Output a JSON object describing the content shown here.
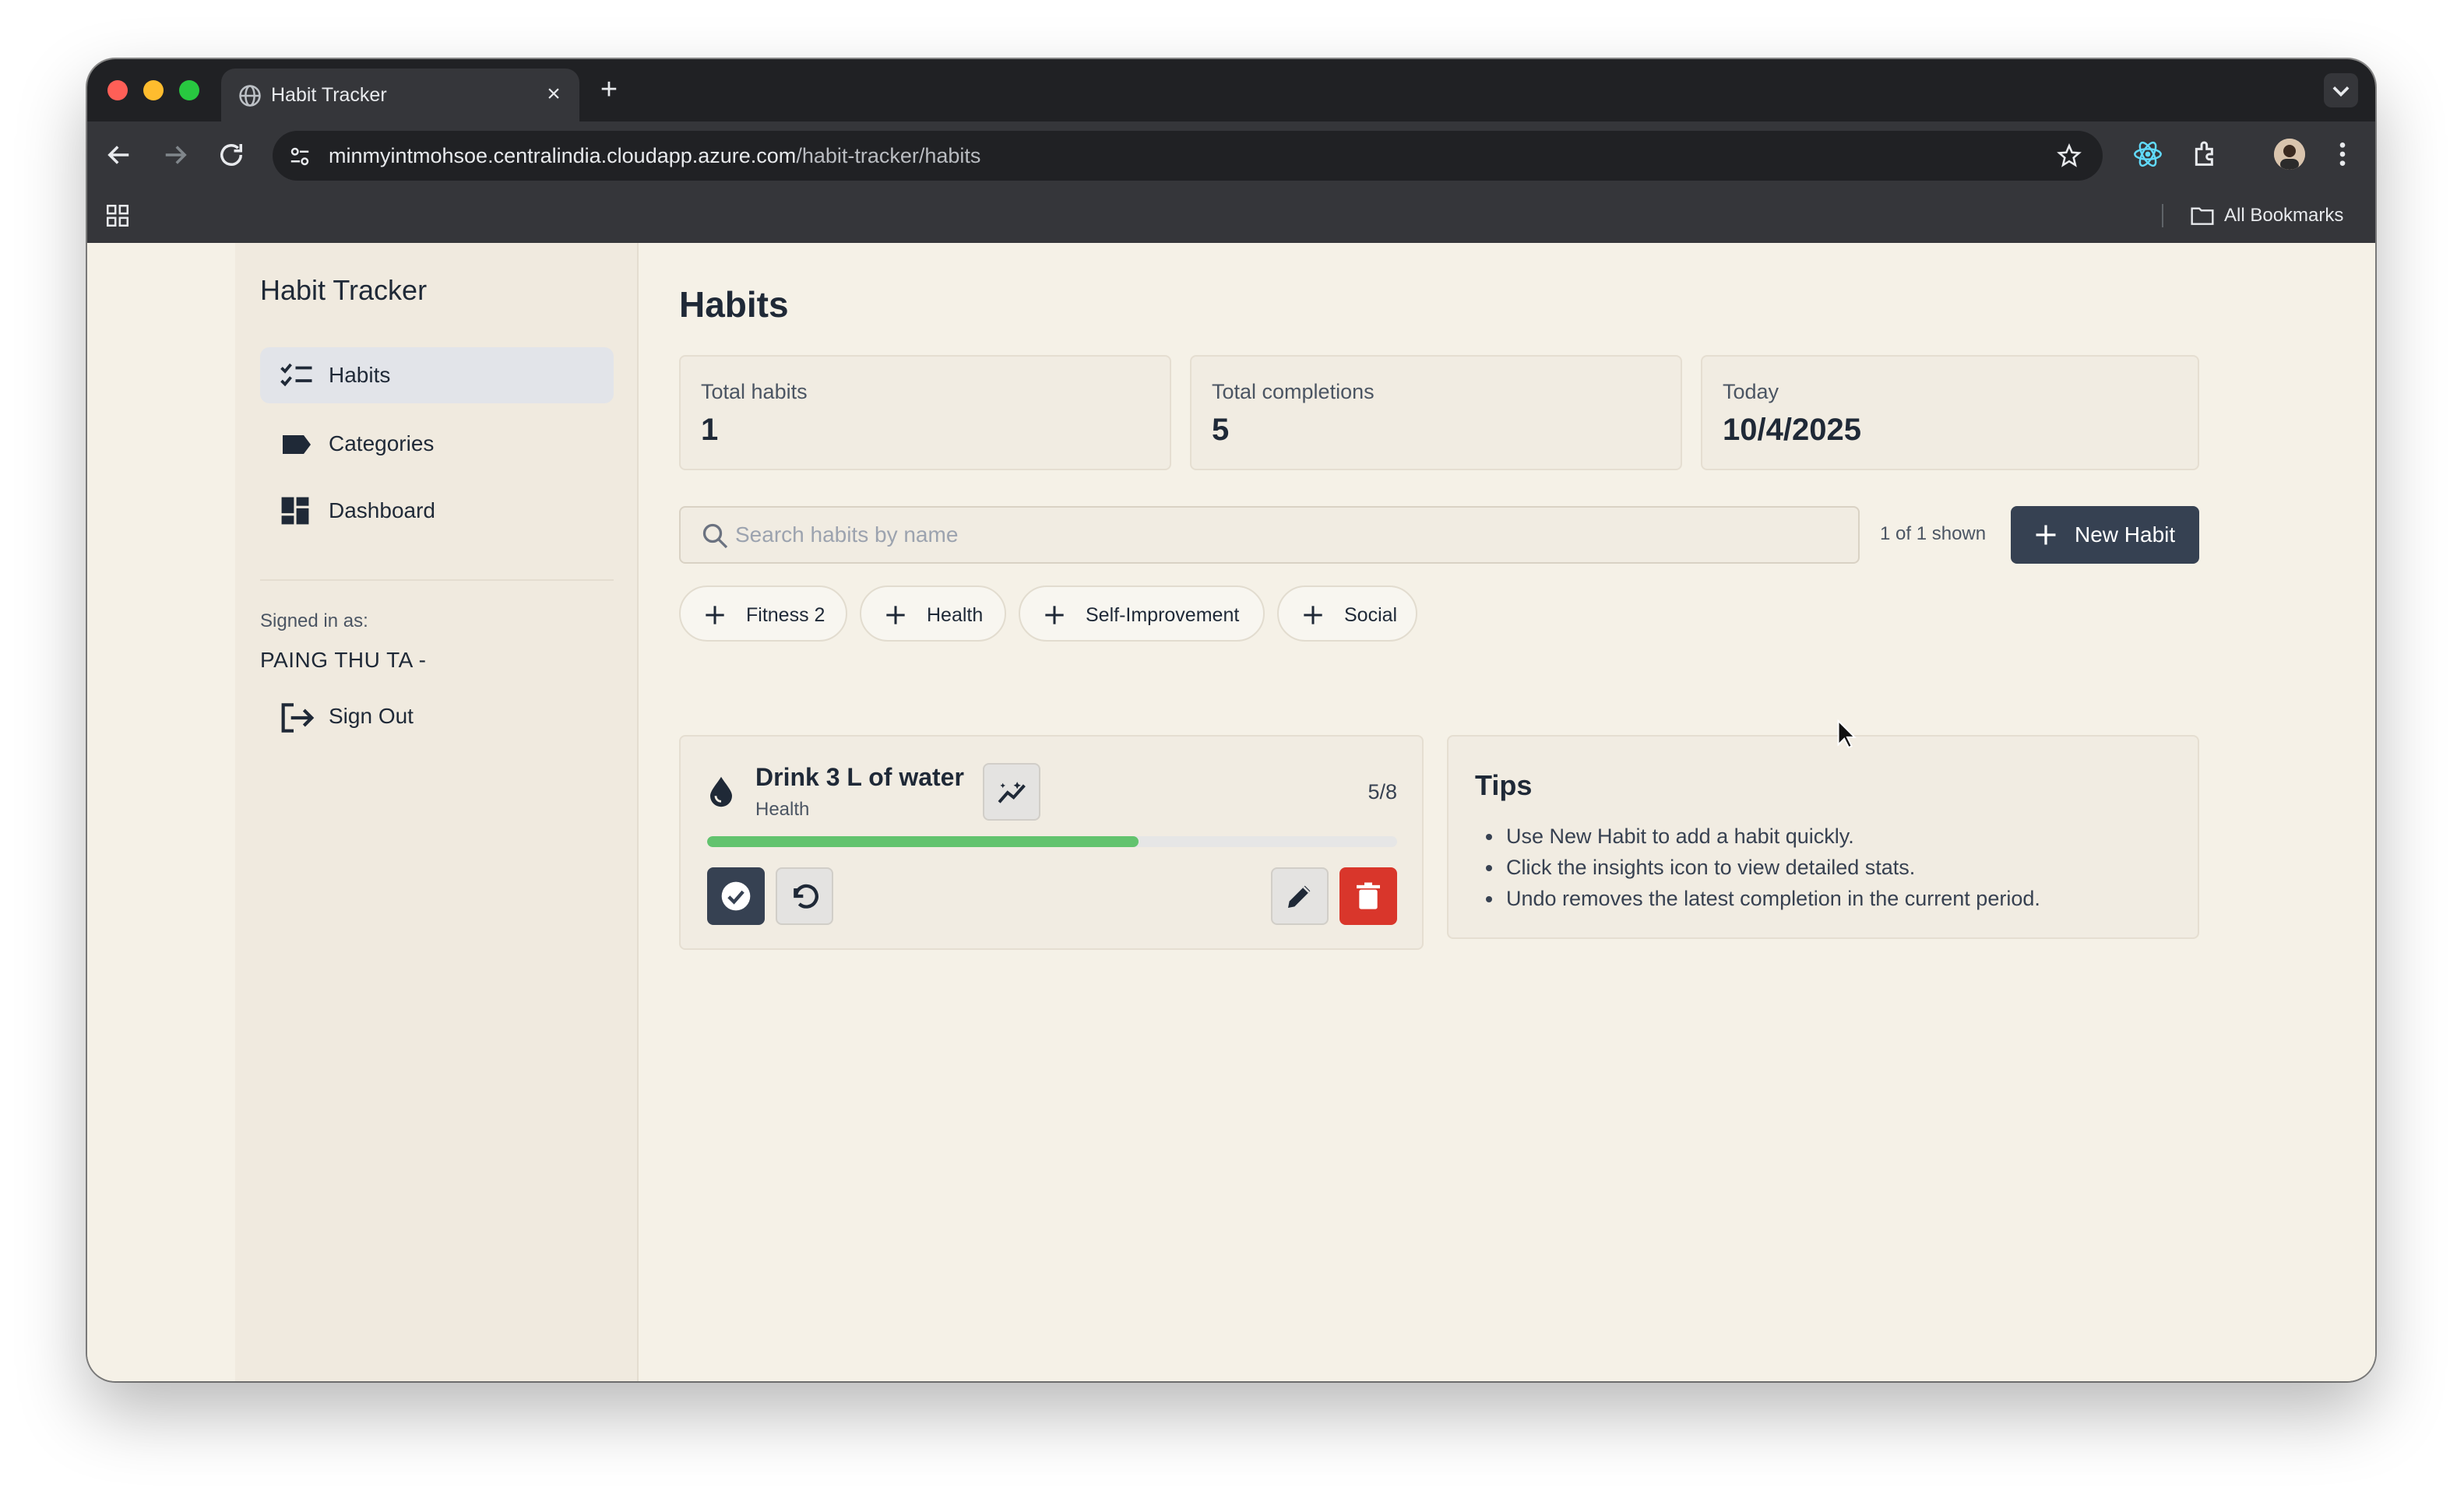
{
  "browser": {
    "tab_title": "Habit Tracker",
    "url_host": "minmyintmohsoe.centralindia.cloudapp.azure.com",
    "url_path": "/habit-tracker/habits",
    "bookmarks_label": "All Bookmarks"
  },
  "sidebar": {
    "brand": "Habit Tracker",
    "items": [
      {
        "label": "Habits",
        "icon": "checklist-icon",
        "active": true
      },
      {
        "label": "Categories",
        "icon": "label-icon",
        "active": false
      },
      {
        "label": "Dashboard",
        "icon": "dashboard-icon",
        "active": false
      }
    ],
    "signed_in_label": "Signed in as:",
    "user_name": "PAING THU TA -",
    "sign_out_label": "Sign Out"
  },
  "main": {
    "title": "Habits",
    "stats": [
      {
        "label": "Total habits",
        "value": "1"
      },
      {
        "label": "Total completions",
        "value": "5"
      },
      {
        "label": "Today",
        "value": "10/4/2025"
      }
    ],
    "search": {
      "placeholder": "Search habits by name",
      "value": ""
    },
    "shown_text": "1 of 1 shown",
    "new_habit_label": "New Habit",
    "category_chips": [
      "Fitness 2",
      "Health",
      "Self-Improvement",
      "Social"
    ],
    "habit": {
      "name": "Drink 3 L of water",
      "category": "Health",
      "count_text": "5/8",
      "progress_fraction": 0.625
    },
    "tips": {
      "title": "Tips",
      "items": [
        "Use New Habit to add a habit quickly.",
        "Click the insights icon to view detailed stats.",
        "Undo removes the latest completion in the current period."
      ]
    }
  },
  "colors": {
    "primary": "#364152",
    "progress": "#62c36e",
    "danger": "#d9362b",
    "background": "#f5f1e7"
  }
}
